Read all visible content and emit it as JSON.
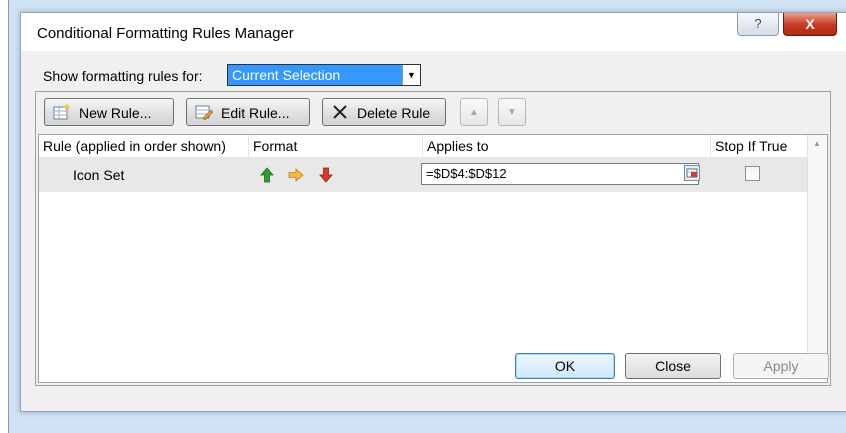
{
  "dialog": {
    "title": "Conditional Formatting Rules Manager",
    "help_label": "?",
    "close_label": "X"
  },
  "filter": {
    "label": "Show formatting rules for:",
    "selected": "Current Selection"
  },
  "toolbar": {
    "new_rule": "New Rule...",
    "edit_rule": "Edit Rule...",
    "delete_rule": "Delete Rule",
    "move_up_icon": "triangle-up",
    "move_down_icon": "triangle-down"
  },
  "grid": {
    "headers": [
      "Rule (applied in order shown)",
      "Format",
      "Applies to",
      "Stop If True"
    ],
    "rows": [
      {
        "rule": "Icon Set",
        "format_icons": [
          "green-up-arrow",
          "yellow-right-arrow",
          "red-down-arrow"
        ],
        "applies_to": "=$D$4:$D$12",
        "stop_if_true": false
      }
    ]
  },
  "buttons": {
    "ok": "OK",
    "close": "Close",
    "apply": "Apply"
  },
  "colors": {
    "accent": "#3399ff",
    "up_arrow": "#2f9e2f",
    "side_arrow": "#f0a030",
    "down_arrow": "#d83a2a"
  }
}
